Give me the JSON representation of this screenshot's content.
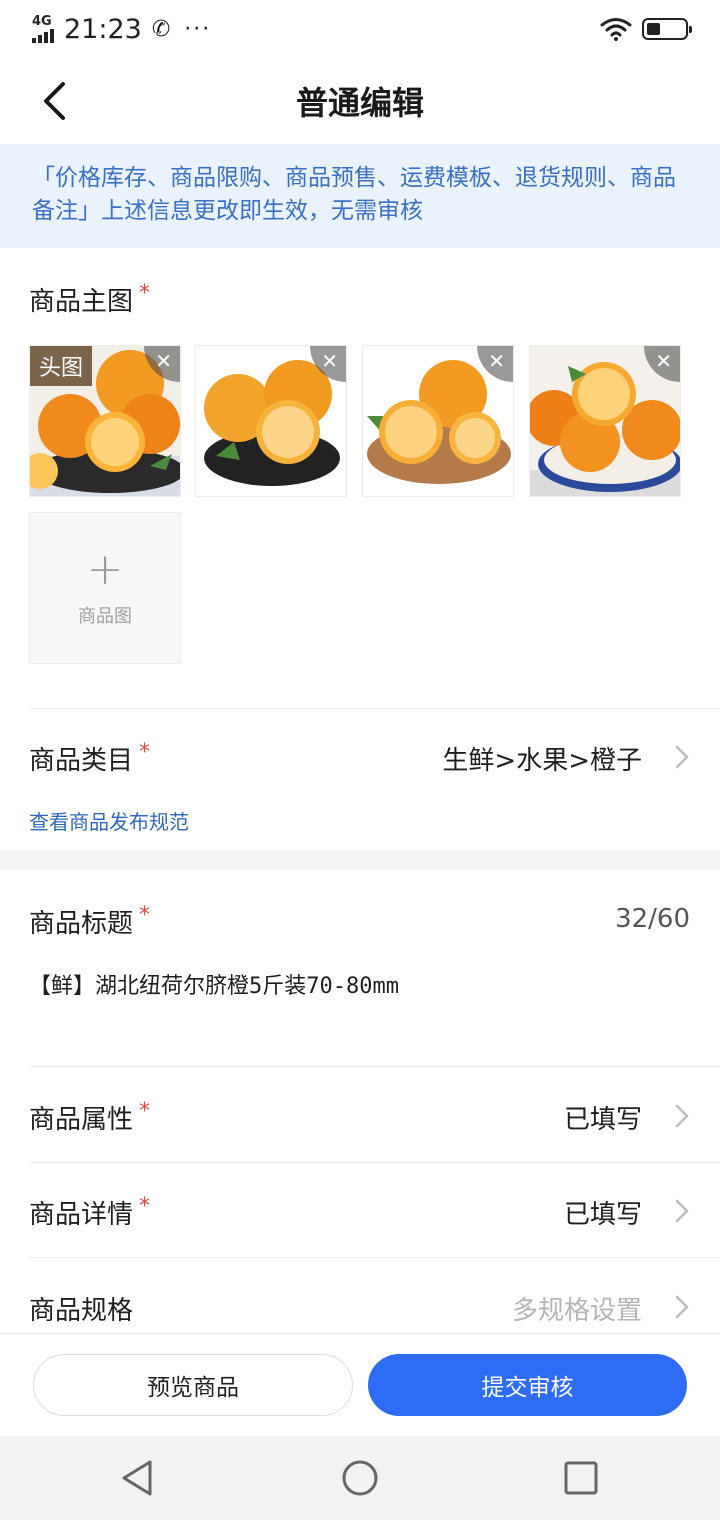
{
  "status_bar": {
    "network": "4G",
    "time": "21:23",
    "battery_level": 0.35
  },
  "header": {
    "title": "普通编辑"
  },
  "notice": {
    "text": "「价格库存、商品限购、商品预售、运费模板、退货规则、商品备注」上述信息更改即生效，无需审核"
  },
  "main_images": {
    "label": "商品主图",
    "required_mark": "*",
    "head_tag": "头图",
    "delete_glyph": "✕",
    "add_plus": "+",
    "add_label": "商品图"
  },
  "category": {
    "label": "商品类目",
    "required_mark": "*",
    "value": "生鲜>水果>橙子",
    "spec_link": "查看商品发布规范"
  },
  "title_field": {
    "label": "商品标题",
    "required_mark": "*",
    "counter": "32/60",
    "value": "【鲜】湖北纽荷尔脐橙5斤装70-80mm"
  },
  "attributes": {
    "label": "商品属性",
    "required_mark": "*",
    "value": "已填写"
  },
  "details": {
    "label": "商品详情",
    "required_mark": "*",
    "value": "已填写"
  },
  "specs": {
    "label": "商品规格",
    "value": "多规格设置"
  },
  "bottom_bar": {
    "preview_label": "预览商品",
    "submit_label": "提交审核"
  },
  "colors": {
    "accent": "#2f6cf6",
    "notice_bg": "#eaf3fd",
    "notice_text": "#3b6fc4",
    "required": "#e5483f",
    "link": "#2f68b8"
  }
}
